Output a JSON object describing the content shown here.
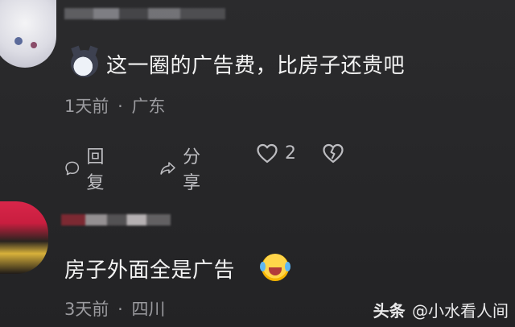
{
  "comments": [
    {
      "text": "这一圈的广告费，比房子还贵吧",
      "time": "1天前",
      "location": "广东",
      "sep": "·",
      "actions": {
        "reply": "回复",
        "share": "分享",
        "like_count": "2"
      },
      "emoji": "cat-face-emoji"
    },
    {
      "text": "房子外面全是广告",
      "time": "3天前",
      "location": "四川",
      "sep": "·",
      "emoji": "crying-laughing-emoji"
    }
  ],
  "watermark": {
    "brand": "头条",
    "sep": "@",
    "author": "小水看人间"
  },
  "icons": [
    "reply-icon",
    "share-icon",
    "heart-icon",
    "broken-heart-icon"
  ]
}
